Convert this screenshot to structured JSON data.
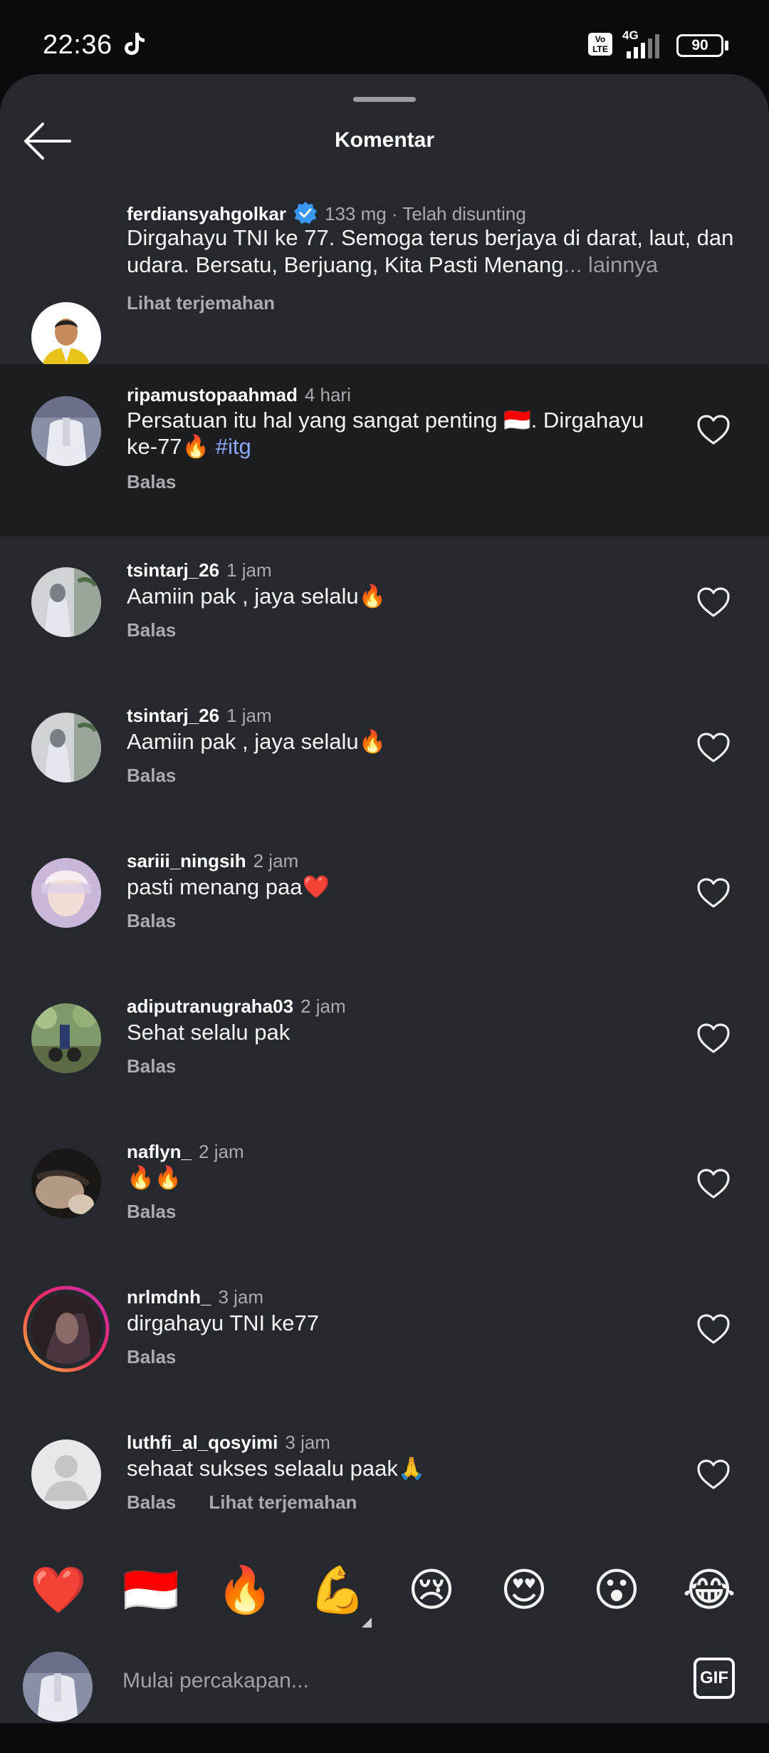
{
  "status_bar": {
    "time": "22:36",
    "volte_label": "Vo LTE",
    "network": "4G",
    "battery": "90"
  },
  "header": {
    "title": "Komentar"
  },
  "caption": {
    "username": "ferdiansyahgolkar",
    "meta": "133 mg · Telah disunting",
    "text_line1": "Dirgahayu TNI ke 77. Semoga terus berjaya di darat, laut, dan",
    "text_line2": "udara. Bersatu, Berjuang, Kita Pasti Menang",
    "more": "... lainnya",
    "translate": "Lihat terjemahan"
  },
  "comments": [
    {
      "username": "ripamustopaahmad",
      "time": "4 hari",
      "text_line1": "Persatuan itu hal yang sangat penting 🇮🇩. Dirgahayu",
      "text_line2": "ke-77🔥",
      "hashtag": "#itg",
      "reply": "Balas"
    },
    {
      "username": "tsintarj_26",
      "time": "1 jam",
      "text": "Aamiin pak , jaya selalu🔥",
      "reply": "Balas"
    },
    {
      "username": "tsintarj_26",
      "time": "1 jam",
      "text": "Aamiin pak , jaya selalu🔥",
      "reply": "Balas"
    },
    {
      "username": "sariii_ningsih",
      "time": "2 jam",
      "text": "pasti menang paa❤️",
      "reply": "Balas"
    },
    {
      "username": "adiputranugraha03",
      "time": "2 jam",
      "text": "Sehat selalu pak",
      "reply": "Balas"
    },
    {
      "username": "naflyn_",
      "time": "2 jam",
      "text": "🔥🔥",
      "reply": "Balas"
    },
    {
      "username": "nrlmdnh_",
      "time": "3 jam",
      "text": "dirgahayu TNI ke77",
      "reply": "Balas"
    },
    {
      "username": "luthfi_al_qosyimi",
      "time": "3 jam",
      "text": "sehaat sukses selaalu paak🙏",
      "reply": "Balas",
      "translate": "Lihat terjemahan"
    }
  ],
  "emoji_bar": [
    "❤️",
    "🇮🇩",
    "🔥",
    "💪",
    "😢",
    "😍",
    "😮",
    "😂"
  ],
  "composer": {
    "placeholder": "Mulai percakapan...",
    "gif_label": "GIF"
  },
  "colors": {
    "sheet_bg": "#25282c",
    "highlight_bg": "#1c1d1f",
    "hashtag": "#8ea6ff",
    "verified": "#3897f0"
  }
}
